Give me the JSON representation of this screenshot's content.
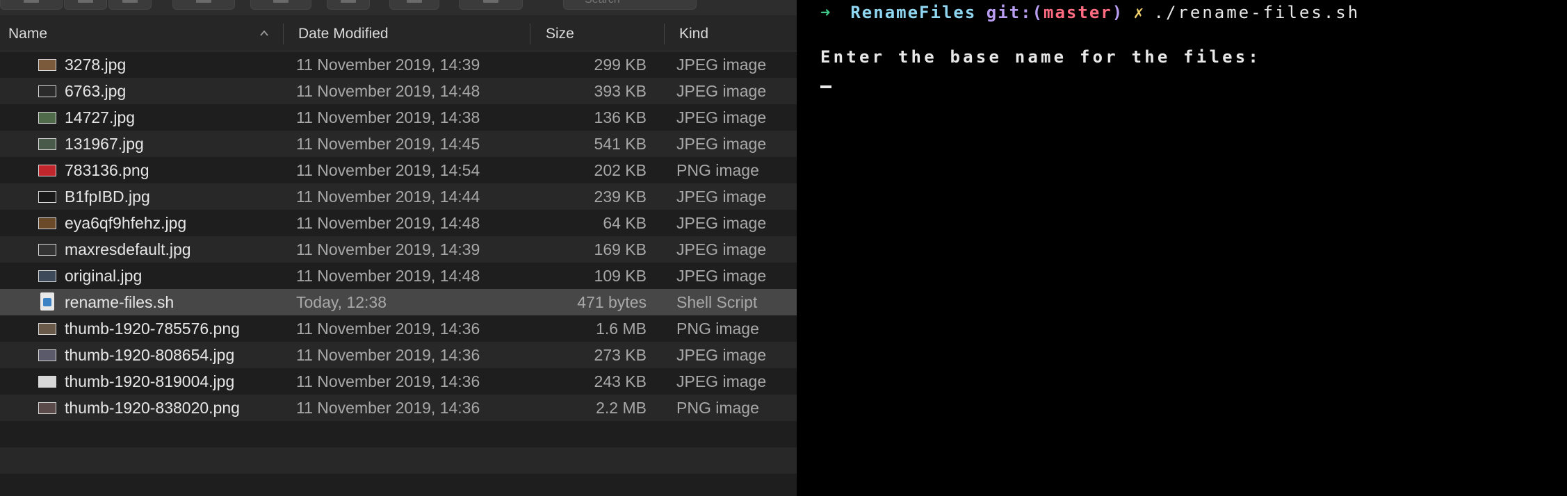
{
  "finder": {
    "columns": {
      "name": "Name",
      "date": "Date Modified",
      "size": "Size",
      "kind": "Kind"
    },
    "search_placeholder": "Search",
    "files": [
      {
        "name": "3278.jpg",
        "date": "11 November 2019, 14:39",
        "size": "299 KB",
        "kind": "JPEG image",
        "thumb_color": "#7a5a3a"
      },
      {
        "name": "6763.jpg",
        "date": "11 November 2019, 14:48",
        "size": "393 KB",
        "kind": "JPEG image",
        "thumb_color": "#2b2b2b"
      },
      {
        "name": "14727.jpg",
        "date": "11 November 2019, 14:38",
        "size": "136 KB",
        "kind": "JPEG image",
        "thumb_color": "#4f6b4a"
      },
      {
        "name": "131967.jpg",
        "date": "11 November 2019, 14:45",
        "size": "541 KB",
        "kind": "JPEG image",
        "thumb_color": "#4a5a4a"
      },
      {
        "name": "783136.png",
        "date": "11 November 2019, 14:54",
        "size": "202 KB",
        "kind": "PNG image",
        "thumb_color": "#c0262b"
      },
      {
        "name": "B1fpIBD.jpg",
        "date": "11 November 2019, 14:44",
        "size": "239 KB",
        "kind": "JPEG image",
        "thumb_color": "#1a1a1a"
      },
      {
        "name": "eya6qf9hfehz.jpg",
        "date": "11 November 2019, 14:48",
        "size": "64 KB",
        "kind": "JPEG image",
        "thumb_color": "#6b4a2a"
      },
      {
        "name": "maxresdefault.jpg",
        "date": "11 November 2019, 14:39",
        "size": "169 KB",
        "kind": "JPEG image",
        "thumb_color": "#333333"
      },
      {
        "name": "original.jpg",
        "date": "11 November 2019, 14:48",
        "size": "109 KB",
        "kind": "JPEG image",
        "thumb_color": "#3c4a5a"
      },
      {
        "name": "rename-files.sh",
        "date": "Today, 12:38",
        "size": "471 bytes",
        "kind": "Shell Script",
        "thumb_color": "#3b82c4",
        "selected": true,
        "icon": "shell-script-icon"
      },
      {
        "name": "thumb-1920-785576.png",
        "date": "11 November 2019, 14:36",
        "size": "1.6 MB",
        "kind": "PNG image",
        "thumb_color": "#6a5a4a"
      },
      {
        "name": "thumb-1920-808654.jpg",
        "date": "11 November 2019, 14:36",
        "size": "273 KB",
        "kind": "JPEG image",
        "thumb_color": "#5a5a6a"
      },
      {
        "name": "thumb-1920-819004.jpg",
        "date": "11 November 2019, 14:36",
        "size": "243 KB",
        "kind": "JPEG image",
        "thumb_color": "#d8d8d8"
      },
      {
        "name": "thumb-1920-838020.png",
        "date": "11 November 2019, 14:36",
        "size": "2.2 MB",
        "kind": "PNG image",
        "thumb_color": "#5a4a4a"
      }
    ],
    "sort_column": "name",
    "sort_direction": "ascending"
  },
  "terminal": {
    "prompt_arrow": "➜",
    "directory": "RenameFiles",
    "git_prefix": "git:(",
    "branch": "master",
    "git_suffix": ")",
    "dirty_marker": "✗",
    "command": "./rename-files.sh",
    "output_line": "Enter the base name for the files:",
    "colors": {
      "arrow": "#3fc98a",
      "directory": "#8fd6f0",
      "git": "#b89cf0",
      "branch": "#ff6b81",
      "dirty": "#f2d16b"
    }
  }
}
